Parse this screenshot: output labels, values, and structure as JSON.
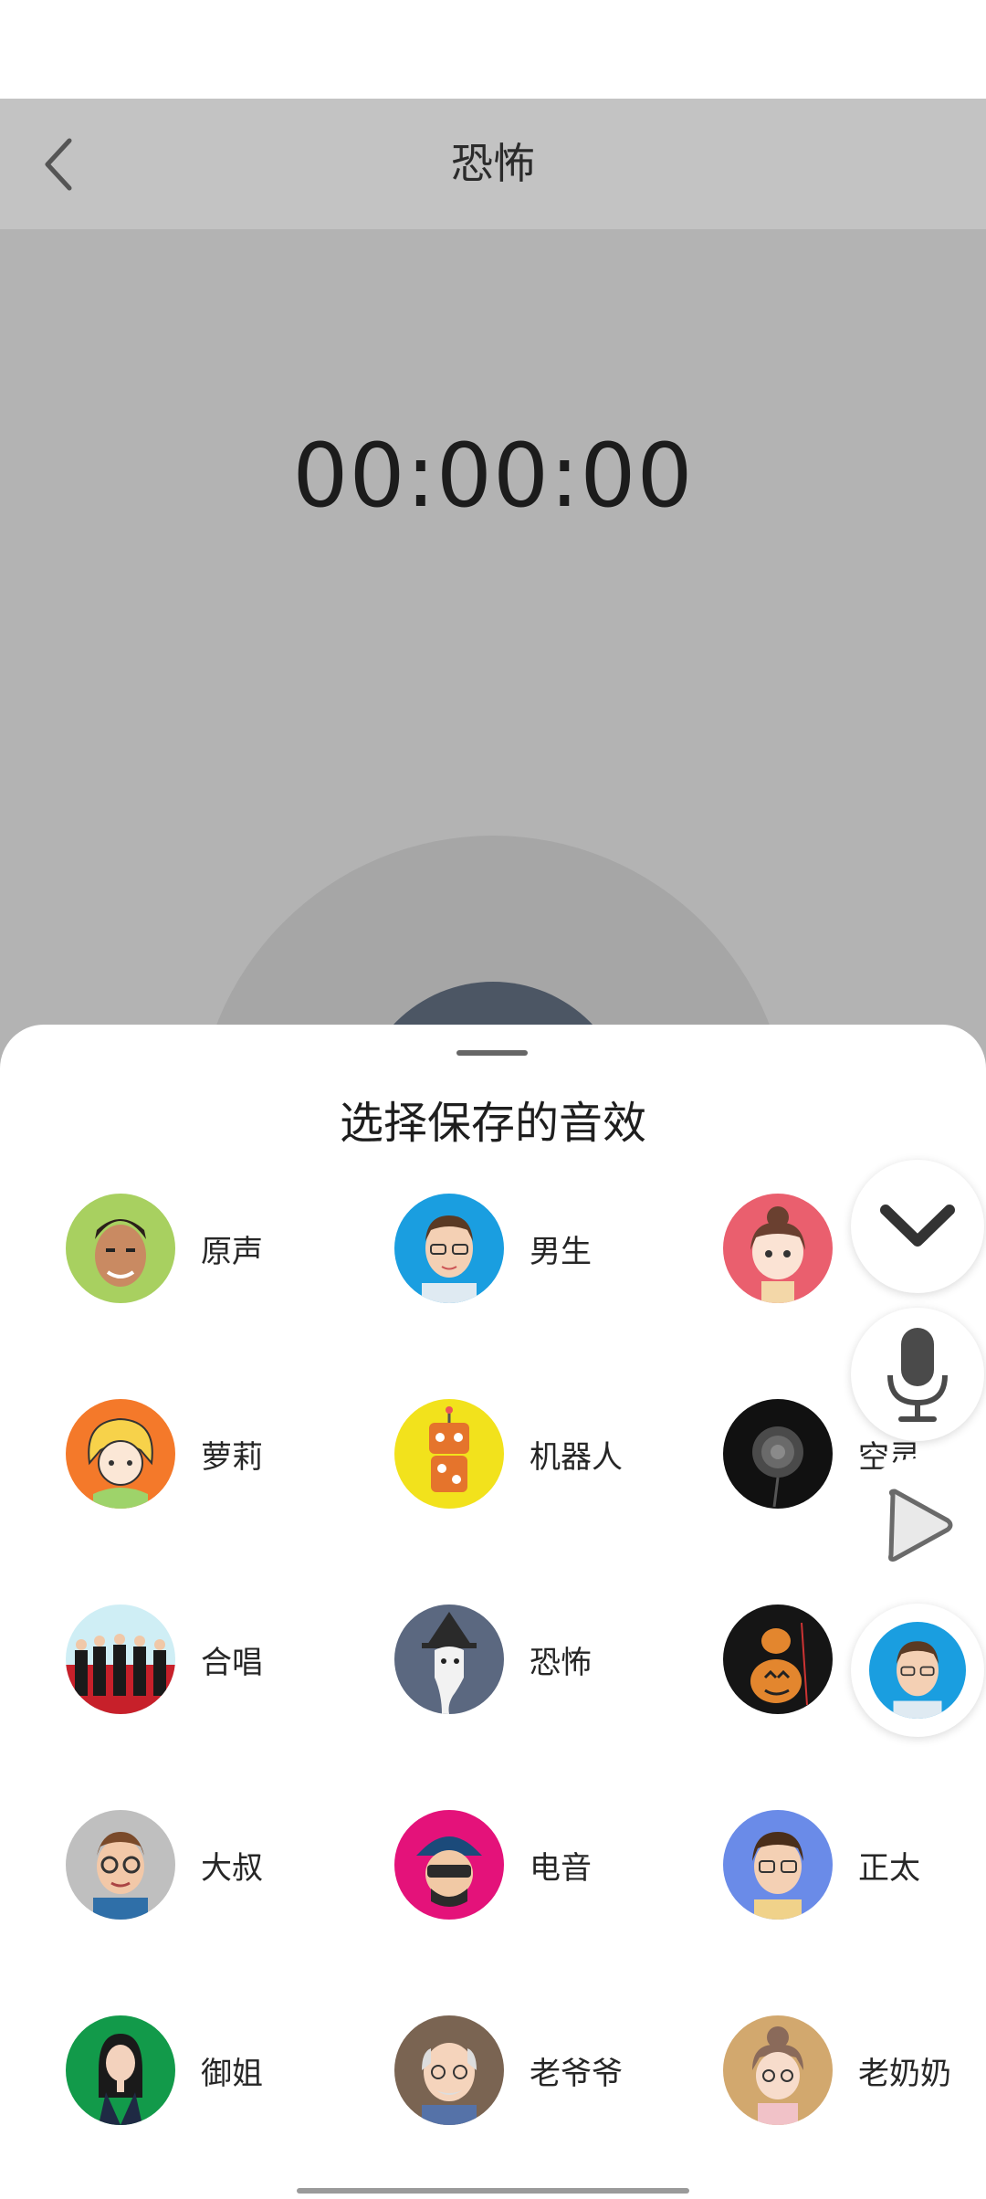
{
  "header": {
    "title": "恐怖"
  },
  "timer": {
    "value": "00:00:00"
  },
  "sheet": {
    "title": "选择保存的音效",
    "items": [
      {
        "label": "原声",
        "icon": "avatar-original-icon"
      },
      {
        "label": "男生",
        "icon": "avatar-male-icon"
      },
      {
        "label": "",
        "icon": "avatar-girl-icon"
      },
      {
        "label": "萝莉",
        "icon": "avatar-loli-icon"
      },
      {
        "label": "机器人",
        "icon": "avatar-robot-icon"
      },
      {
        "label": "空灵",
        "icon": "avatar-ethereal-icon"
      },
      {
        "label": "合唱",
        "icon": "avatar-chorus-icon"
      },
      {
        "label": "恐怖",
        "icon": "avatar-horror-icon"
      },
      {
        "label": "",
        "icon": "avatar-pumpkin-icon"
      },
      {
        "label": "大叔",
        "icon": "avatar-uncle-icon"
      },
      {
        "label": "电音",
        "icon": "avatar-electronic-icon"
      },
      {
        "label": "正太",
        "icon": "avatar-boy-icon"
      },
      {
        "label": "御姐",
        "icon": "avatar-lady-icon"
      },
      {
        "label": "老爷爷",
        "icon": "avatar-grandpa-icon"
      },
      {
        "label": "老奶奶",
        "icon": "avatar-grandma-icon"
      }
    ]
  },
  "floating": {
    "collapse": "chevron-down-icon",
    "mic": "microphone-icon",
    "play": "play-icon",
    "avatar": "avatar-male-icon"
  },
  "colors": {
    "overlay": "#b3b3b3",
    "appbar": "#c3c3c3",
    "record_inner": "#4c5664"
  }
}
